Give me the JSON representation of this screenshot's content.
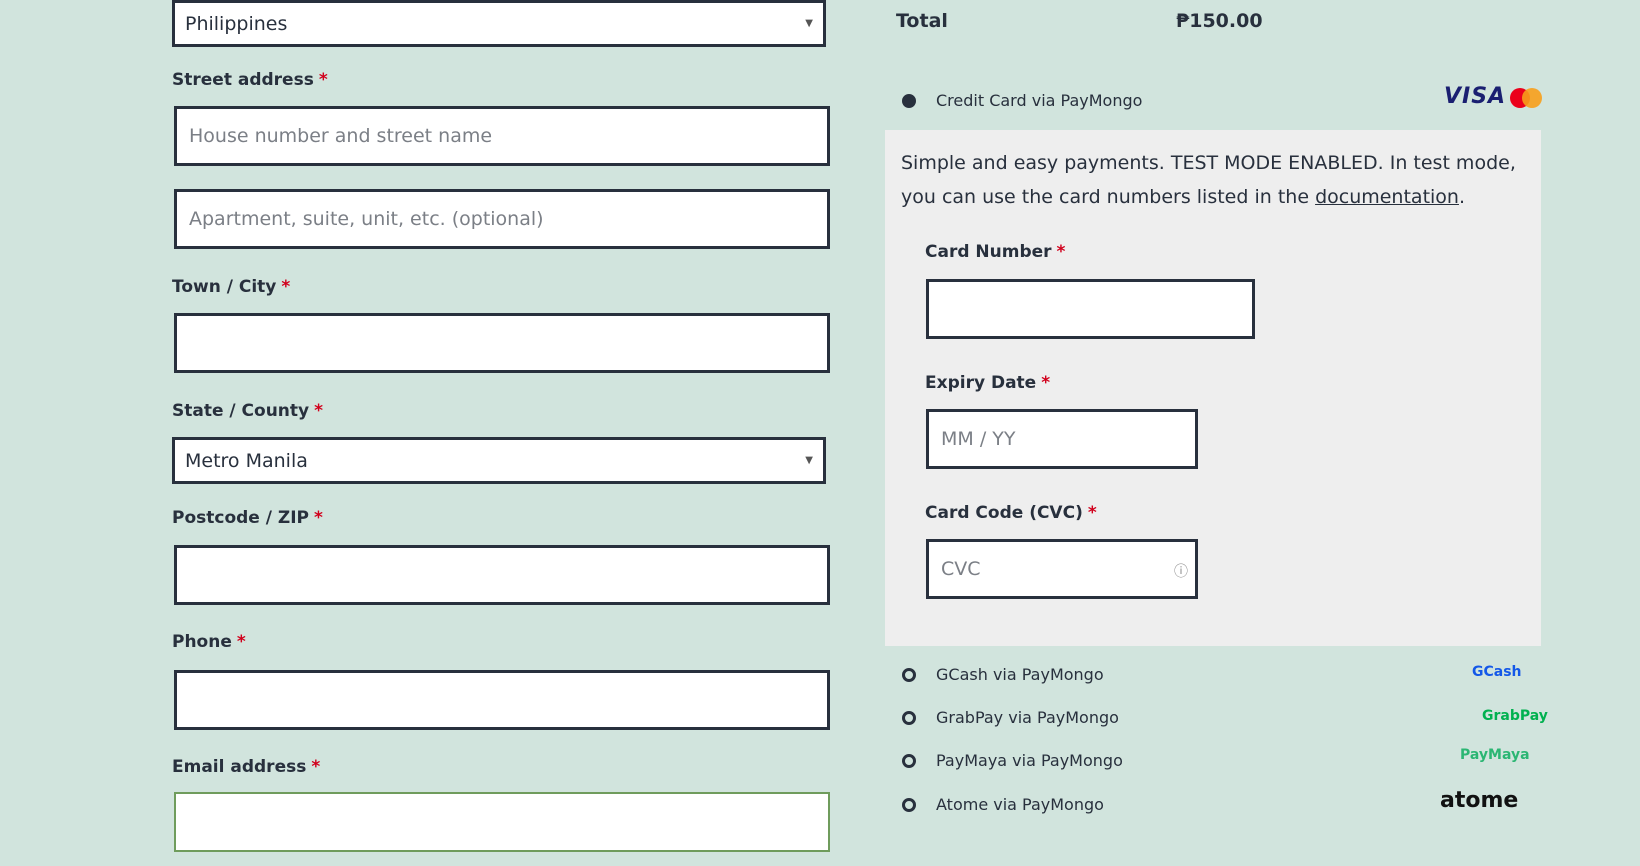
{
  "billing": {
    "country_value": "Philippines",
    "street_label": "Street address",
    "street_placeholder": "House number and street name",
    "apt_placeholder": "Apartment, suite, unit, etc. (optional)",
    "city_label": "Town / City",
    "state_label": "State / County",
    "state_value": "Metro Manila",
    "postcode_label": "Postcode / ZIP",
    "phone_label": "Phone",
    "email_label": "Email address",
    "required_mark": "*"
  },
  "order": {
    "total_label": "Total",
    "total_value": "₱150.00"
  },
  "payment": {
    "credit_card_label": "Credit Card via PayMongo",
    "description_text": "Simple and easy payments. TEST MODE ENABLED. In test mode, you can use the card numbers listed in the ",
    "doc_link": "documentation",
    "description_end": ".",
    "card_number_label": "Card Number",
    "expiry_label": "Expiry Date",
    "expiry_placeholder": "MM / YY",
    "cvc_label": "Card Code (CVC)",
    "cvc_placeholder": "CVC",
    "methods": [
      {
        "label": "GCash via PayMongo",
        "brand": "GCash"
      },
      {
        "label": "GrabPay via PayMongo",
        "brand": "GrabPay"
      },
      {
        "label": "PayMaya via PayMongo",
        "brand": "PayMaya"
      },
      {
        "label": "Atome via PayMongo",
        "brand": "atome"
      }
    ],
    "card_brands": {
      "visa": "VISA"
    },
    "colors": {
      "mc_red": "#eb001b",
      "mc_orange": "#f79e1b"
    }
  }
}
